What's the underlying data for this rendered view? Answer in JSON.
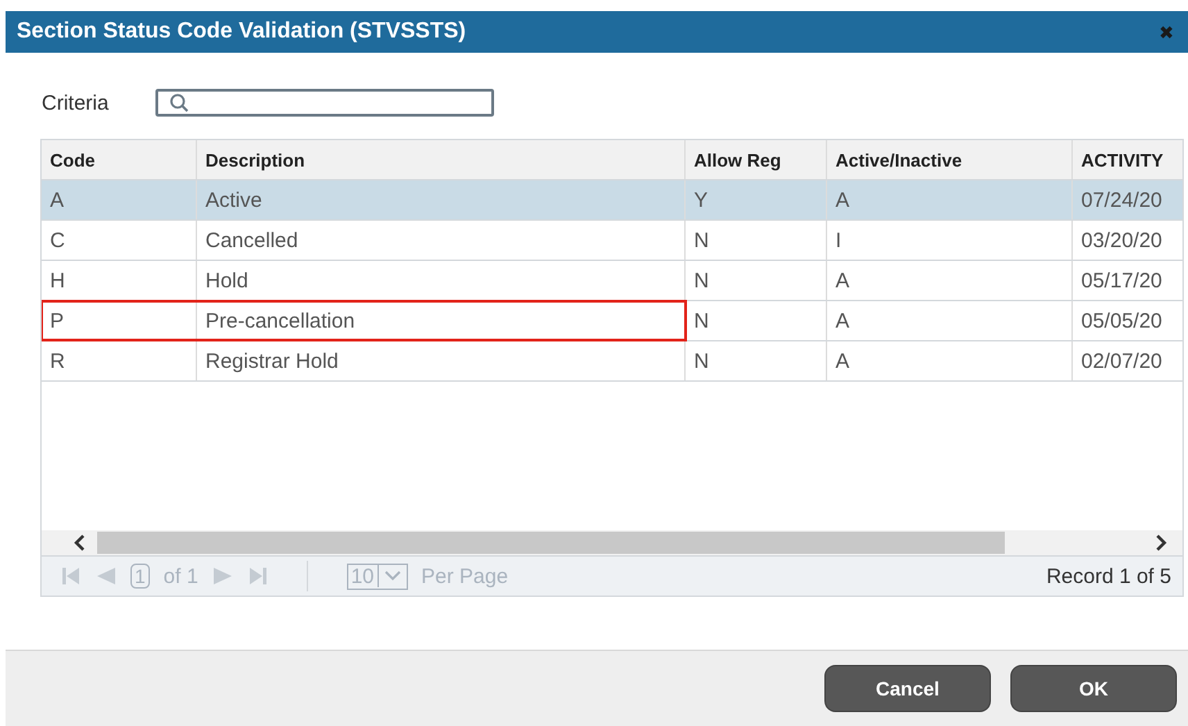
{
  "window": {
    "title": "Section Status Code Validation (STVSSTS)",
    "close": "✖"
  },
  "criteria": {
    "label": "Criteria"
  },
  "table": {
    "columns": [
      "Code",
      "Description",
      "Allow Reg",
      "Active/Inactive",
      "ACTIVITY"
    ],
    "rows": [
      {
        "cells": [
          "A",
          "Active",
          "Y",
          "A",
          "07/24/20"
        ],
        "selected": true,
        "highlighted": false
      },
      {
        "cells": [
          "C",
          "Cancelled",
          "N",
          "I",
          "03/20/20"
        ],
        "selected": false,
        "highlighted": false
      },
      {
        "cells": [
          "H",
          "Hold",
          "N",
          "A",
          "05/17/20"
        ],
        "selected": false,
        "highlighted": false
      },
      {
        "cells": [
          "P",
          "Pre-cancellation",
          "N",
          "A",
          "05/05/20"
        ],
        "selected": false,
        "highlighted": true
      },
      {
        "cells": [
          "R",
          "Registrar Hold",
          "N",
          "A",
          "02/07/20"
        ],
        "selected": false,
        "highlighted": false
      }
    ]
  },
  "pager": {
    "page": "1",
    "of": "of 1",
    "per_page": "10",
    "per_page_label": "Per Page",
    "record": "Record 1 of 5"
  },
  "buttons": [
    "Cancel",
    "OK"
  ]
}
